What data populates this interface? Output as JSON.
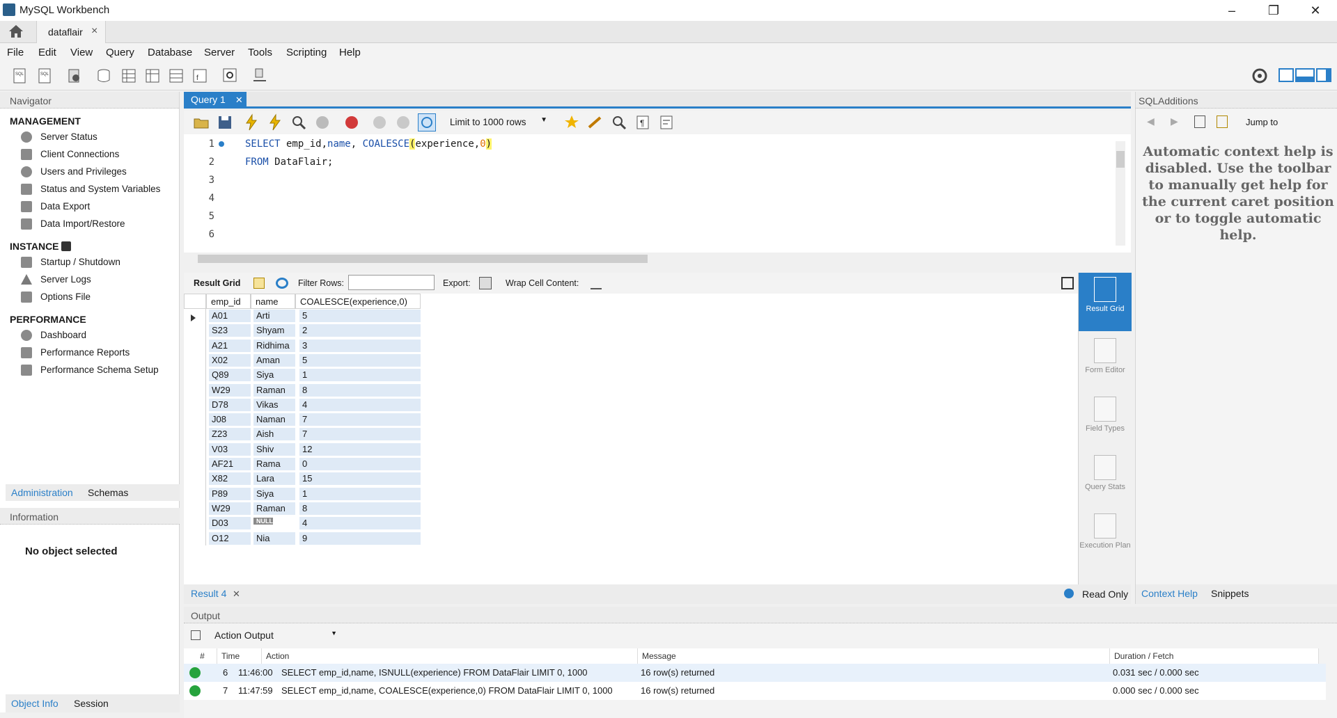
{
  "app": {
    "title": "MySQL Workbench"
  },
  "tabs": {
    "connection": "dataflair",
    "close": "×"
  },
  "menu": [
    "File",
    "Edit",
    "View",
    "Query",
    "Database",
    "Server",
    "Tools",
    "Scripting",
    "Help"
  ],
  "navigator": {
    "title": "Navigator",
    "management": {
      "title": "MANAGEMENT",
      "items": [
        "Server Status",
        "Client Connections",
        "Users and Privileges",
        "Status and System Variables",
        "Data Export",
        "Data Import/Restore"
      ]
    },
    "instance": {
      "title": "INSTANCE",
      "items": [
        "Startup / Shutdown",
        "Server Logs",
        "Options File"
      ]
    },
    "performance": {
      "title": "PERFORMANCE",
      "items": [
        "Dashboard",
        "Performance Reports",
        "Performance Schema Setup"
      ]
    },
    "tab_admin": "Administration",
    "tab_schemas": "Schemas",
    "info_title": "Information",
    "no_object": "No object selected",
    "tab_objinfo": "Object Info",
    "tab_session": "Session"
  },
  "query": {
    "tab": "Query 1",
    "limit": "Limit to 1000 rows",
    "lines": [
      "1",
      "2",
      "3",
      "4",
      "5",
      "6"
    ],
    "sql1_kw": "SELECT",
    "sql1_a": " emp_id,",
    "sql1_name": "name",
    ",": ",",
    "sql1_fn": " COALESCE",
    "sql1_paren": "(",
    "sql1_b": "experience,",
    "sql1_zero": "0",
    "sql1_close": ")",
    "sql2_kw": "FROM",
    "sql2_rest": " DataFlair;"
  },
  "result": {
    "grid_label": "Result Grid",
    "filter_label": "Filter Rows:",
    "export_label": "Export:",
    "wrap_label": "Wrap Cell Content:",
    "columns": [
      "emp_id",
      "name",
      "COALESCE(experience,0)"
    ],
    "rows": [
      [
        "A01",
        "Arti",
        "5"
      ],
      [
        "S23",
        "Shyam",
        "2"
      ],
      [
        "A21",
        "Ridhima",
        "3"
      ],
      [
        "X02",
        "Aman",
        "5"
      ],
      [
        "Q89",
        "Siya",
        "1"
      ],
      [
        "W29",
        "Raman",
        "8"
      ],
      [
        "D78",
        "Vikas",
        "4"
      ],
      [
        "J08",
        "Naman",
        "7"
      ],
      [
        "Z23",
        "Aish",
        "7"
      ],
      [
        "V03",
        "Shiv",
        "12"
      ],
      [
        "AF21",
        "Rama",
        "0"
      ],
      [
        "X82",
        "Lara",
        "15"
      ],
      [
        "P89",
        "Siya",
        "1"
      ],
      [
        "W29",
        "Raman",
        "8"
      ],
      [
        "D03",
        "NULL",
        "4"
      ],
      [
        "O12",
        "Nia",
        "9"
      ]
    ],
    "side": [
      "Result Grid",
      "Form Editor",
      "Field Types",
      "Query Stats",
      "Execution Plan"
    ],
    "tab": "Result 4",
    "readonly": "Read Only"
  },
  "sqladditions": {
    "title": "SQLAdditions",
    "jump": "Jump to",
    "help": "Automatic context help is disabled. Use the toolbar to manually get help for the current caret position or to toggle automatic help.",
    "tab_context": "Context Help",
    "tab_snippets": "Snippets"
  },
  "output": {
    "title": "Output",
    "selector": "Action Output",
    "columns": [
      "#",
      "Time",
      "Action",
      "Message",
      "Duration / Fetch"
    ],
    "rows": [
      {
        "n": "6",
        "time": "11:46:00",
        "action": "SELECT emp_id,name, ISNULL(experience) FROM DataFlair LIMIT 0, 1000",
        "msg": "16 row(s) returned",
        "dur": "0.031 sec / 0.000 sec"
      },
      {
        "n": "7",
        "time": "11:47:59",
        "action": "SELECT emp_id,name, COALESCE(experience,0) FROM DataFlair LIMIT 0, 1000",
        "msg": "16 row(s) returned",
        "dur": "0.000 sec / 0.000 sec"
      }
    ]
  },
  "colors": {
    "accent": "#2a7fc8",
    "ok": "#26a33d",
    "highlight": "#fff36b"
  }
}
